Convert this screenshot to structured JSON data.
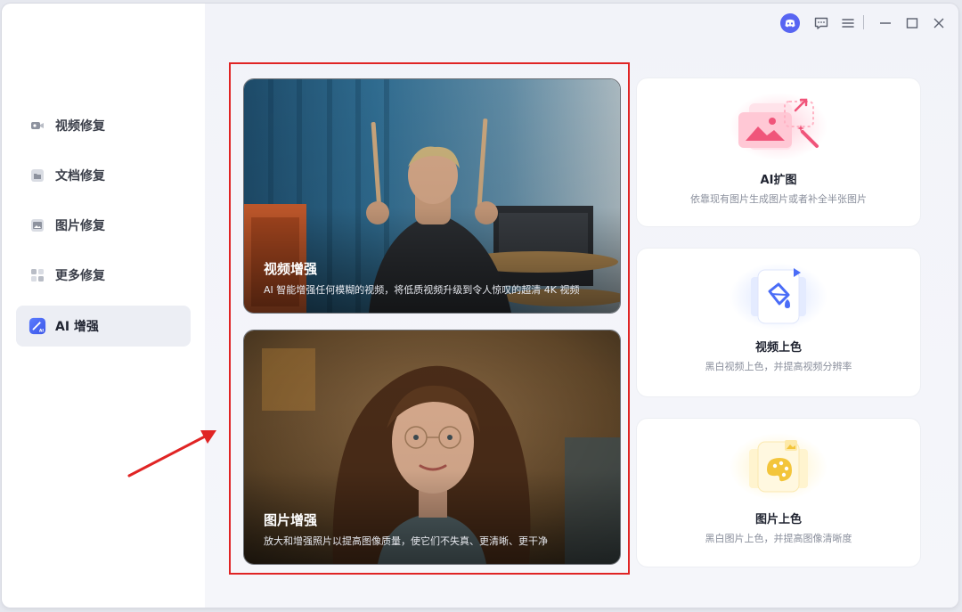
{
  "sidebar": {
    "items": [
      {
        "label": "视频修复",
        "icon": "video-icon"
      },
      {
        "label": "文档修复",
        "icon": "document-icon"
      },
      {
        "label": "图片修复",
        "icon": "image-icon"
      },
      {
        "label": "更多修复",
        "icon": "grid-icon"
      },
      {
        "label": "AI 增强",
        "icon": "ai-magic-icon",
        "active": true
      }
    ]
  },
  "titlebar": {
    "icons": [
      "discord-icon",
      "feedback-icon",
      "menu-icon",
      "minimize-icon",
      "maximize-icon",
      "close-icon"
    ]
  },
  "main": {
    "large_cards": [
      {
        "title": "视频增强",
        "description": "AI 智能增强任何模糊的视频，将低质视频升级到令人惊叹的超清 4K 视频"
      },
      {
        "title": "图片增强",
        "description": "放大和增强照片以提高图像质量，使它们不失真、更清晰、更干净"
      }
    ],
    "small_cards": [
      {
        "title": "AI扩图",
        "description": "依靠现有图片生成图片或者补全半张图片",
        "icon": "image-expand-icon"
      },
      {
        "title": "视频上色",
        "description": "黑白视频上色，并提高视频分辨率",
        "icon": "paint-bucket-icon"
      },
      {
        "title": "图片上色",
        "description": "黑白图片上色，并提高图像清晰度",
        "icon": "palette-icon"
      }
    ]
  },
  "colors": {
    "accent": "#4a6cf7",
    "highlight": "#e02424"
  }
}
